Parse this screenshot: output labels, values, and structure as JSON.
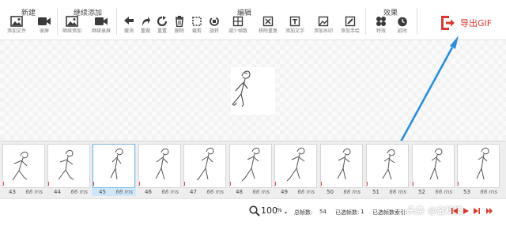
{
  "toolbar": {
    "groups": {
      "new": {
        "title": "新建"
      },
      "continue_add": {
        "title": "继续添加"
      },
      "edit": {
        "title": "编辑"
      },
      "effects": {
        "title": "效果"
      }
    },
    "buttons": {
      "add_file": "添加文件",
      "record": "录屏",
      "continue_add": "继续添加",
      "continue_record": "继续录屏",
      "undo": "撤消",
      "redo": "重做",
      "reset": "重置",
      "delete": "删除",
      "crop": "裁剪",
      "rotate": "旋转",
      "reduce_frames": "减少帧数",
      "remove_duplicates": "移除重复",
      "add_text": "添加文字",
      "add_watermark": "添加水印",
      "add_handwriting": "添加手绘",
      "effects": "特效",
      "timing": "延时"
    },
    "export_label": "导出GIF",
    "colors": {
      "accent": "#d63b2f",
      "arrow": "#2a8fd8",
      "icon": "#3a3a3a"
    }
  },
  "timeline": {
    "frames": [
      {
        "num": "43",
        "ms": "66 ms"
      },
      {
        "num": "44",
        "ms": "66 ms"
      },
      {
        "num": "45",
        "ms": "66 ms"
      },
      {
        "num": "46",
        "ms": "66 ms"
      },
      {
        "num": "47",
        "ms": "66 ms"
      },
      {
        "num": "48",
        "ms": "66 ms"
      },
      {
        "num": "49",
        "ms": "66 ms"
      },
      {
        "num": "50",
        "ms": "66 ms"
      },
      {
        "num": "51",
        "ms": "66 ms"
      },
      {
        "num": "52",
        "ms": "66 ms"
      },
      {
        "num": "53",
        "ms": "66 ms"
      }
    ],
    "selected_frame": "45"
  },
  "status": {
    "zoom_value": "100",
    "zoom_unit": "%",
    "total_frames_label": "总帧数:",
    "total_frames": "54",
    "selected_frames_label": "已选帧数:",
    "selected_frames": "1",
    "selected_index_label": "已选帧数索引:"
  },
  "watermark": "头条 @金科技"
}
